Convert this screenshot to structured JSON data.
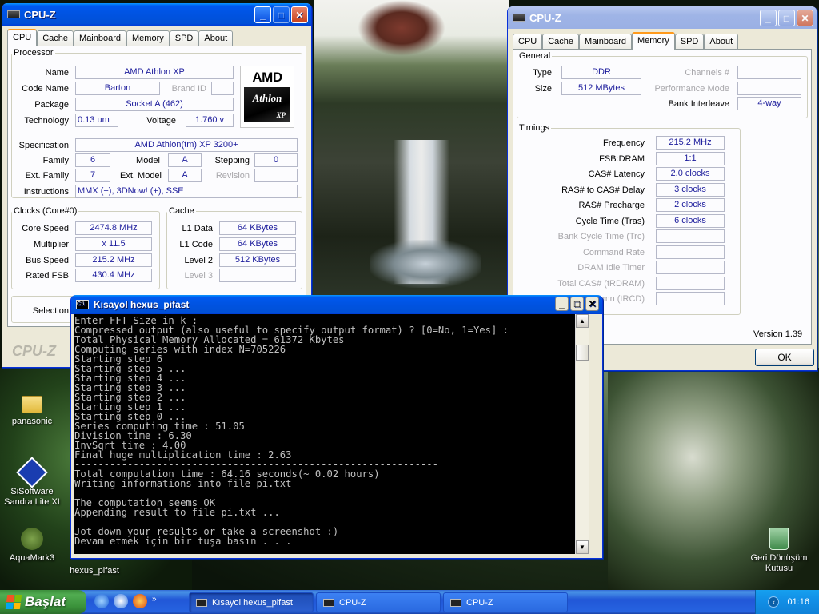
{
  "cpuz_left": {
    "title": "CPU-Z",
    "tabs": [
      "CPU",
      "Cache",
      "Mainboard",
      "Memory",
      "SPD",
      "About"
    ],
    "processor_legend": "Processor",
    "name_label": "Name",
    "name": "AMD Athlon XP",
    "codename_label": "Code Name",
    "codename": "Barton",
    "brandid_label": "Brand ID",
    "package_label": "Package",
    "package": "Socket A (462)",
    "technology_label": "Technology",
    "technology": "0.13 um",
    "voltage_label": "Voltage",
    "voltage": "1.760 v",
    "spec_label": "Specification",
    "spec": "AMD Athlon(tm) XP 3200+",
    "family_label": "Family",
    "family": "6",
    "model_label": "Model",
    "model": "A",
    "stepping_label": "Stepping",
    "stepping": "0",
    "extfamily_label": "Ext. Family",
    "extfamily": "7",
    "extmodel_label": "Ext. Model",
    "extmodel": "A",
    "revision_label": "Revision",
    "instructions_label": "Instructions",
    "instructions": "MMX (+), 3DNow! (+), SSE",
    "logo": {
      "brand": "AMD",
      "product": "Athlon",
      "sub": "XP"
    },
    "clocks_legend": "Clocks (Core#0)",
    "corespeed_label": "Core Speed",
    "corespeed": "2474.8 MHz",
    "multiplier_label": "Multiplier",
    "multiplier": "x 11.5",
    "busspeed_label": "Bus Speed",
    "busspeed": "215.2 MHz",
    "ratedfsb_label": "Rated FSB",
    "ratedfsb": "430.4 MHz",
    "cache_legend": "Cache",
    "l1data_label": "L1 Data",
    "l1data": "64 KBytes",
    "l1code_label": "L1 Code",
    "l1code": "64 KBytes",
    "level2_label": "Level 2",
    "level2": "512 KBytes",
    "level3_label": "Level 3",
    "selection_label": "Selection",
    "watermark": "CPU-Z"
  },
  "cpuz_right": {
    "title": "CPU-Z",
    "tabs": [
      "CPU",
      "Cache",
      "Mainboard",
      "Memory",
      "SPD",
      "About"
    ],
    "general_legend": "General",
    "type_label": "Type",
    "type": "DDR",
    "size_label": "Size",
    "size": "512 MBytes",
    "channels_label": "Channels #",
    "perfmode_label": "Performance Mode",
    "bankinterleave_label": "Bank Interleave",
    "bankinterleave": "4-way",
    "timings_legend": "Timings",
    "frequency_label": "Frequency",
    "frequency": "215.2 MHz",
    "fsbdram_label": "FSB:DRAM",
    "fsbdram": "1:1",
    "cas_label": "CAS# Latency",
    "cas": "2.0 clocks",
    "rcd_label": "RAS# to CAS# Delay",
    "rcd": "3 clocks",
    "rp_label": "RAS# Precharge",
    "rp": "2 clocks",
    "tras_label": "Cycle Time (Tras)",
    "tras": "6 clocks",
    "trc_label": "Bank Cycle Time (Trc)",
    "cr_label": "Command Rate",
    "idle_label": "DRAM Idle Timer",
    "trdram_label": "Total CAS# (tRDRAM)",
    "trcd_label": "mn (tRCD)",
    "version": "Version 1.39",
    "ok_label": "OK"
  },
  "console": {
    "title": "Kısayol hexus_pifast",
    "lines": [
      "Enter FFT Size in k :",
      "Compressed output (also useful to specify output format) ? [0=No, 1=Yes] :",
      "Total Physical Memory Allocated = 61372 Kbytes",
      "Computing series with index N=705226",
      "Starting step 6",
      "Starting step 5 ...",
      "Starting step 4 ...",
      "Starting step 3 ...",
      "Starting step 2 ...",
      "Starting step 1 ...",
      "Starting step 0 ...",
      "Series computing time : 51.05",
      "Division time : 6.30",
      "InvSqrt time : 4.00",
      "Final huge multiplication time : 2.63",
      "--------------------------------------------------------------",
      "Total computation time : 64.16 seconds(~ 0.02 hours)",
      "Writing informations into file pi.txt",
      "",
      "The computation seems OK",
      "Appending result to file pi.txt ...",
      "",
      "Jot down your results or take a screenshot :)",
      "Devam etmek için bir tuşa basın . . ."
    ]
  },
  "desktop": {
    "icons": [
      "panasonic",
      "SiSoftware Sandra Lite XI",
      "AquaMark3",
      "hexus_pifast",
      "Geri Dönüşüm Kutusu"
    ]
  },
  "taskbar": {
    "start_label": "Başlat",
    "items": [
      "Kısayol hexus_pifast",
      "CPU-Z",
      "CPU-Z"
    ],
    "clock": "01:16"
  }
}
